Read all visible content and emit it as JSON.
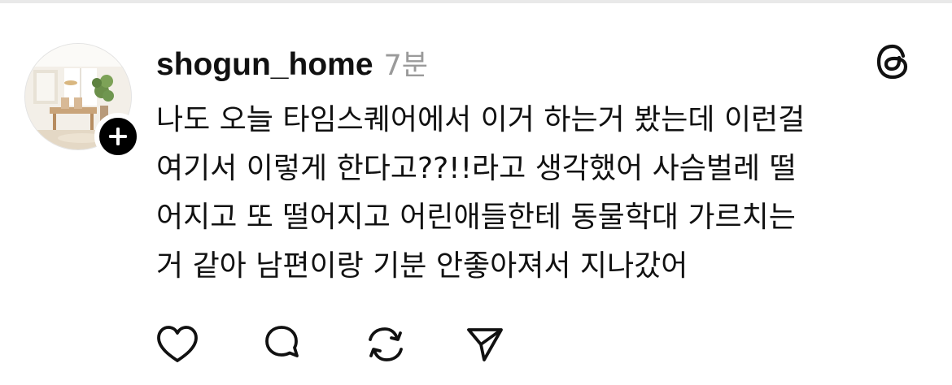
{
  "post": {
    "username": "shogun_home",
    "timestamp": "7분",
    "lines": [
      "나도 오늘 타임스퀘어에서 이거 하는거 봤는데 이런걸",
      "여기서 이렇게 한다고??!!라고 생각했어 사슴벌레 떨",
      "어지고 또 떨어지고 어린애들한테 동물학대 가르치는",
      "거 같아 남편이랑 기분 안좋아져서 지나갔어"
    ]
  },
  "icons": {
    "avatar": "profile-photo",
    "follow": "plus-icon",
    "logo": "threads-logo-icon",
    "like": "heart-icon",
    "reply": "comment-bubble-icon",
    "repost": "repost-icon",
    "share": "send-icon"
  },
  "colors": {
    "text": "#111111",
    "muted": "#9a9a9a",
    "background": "#ffffff"
  }
}
